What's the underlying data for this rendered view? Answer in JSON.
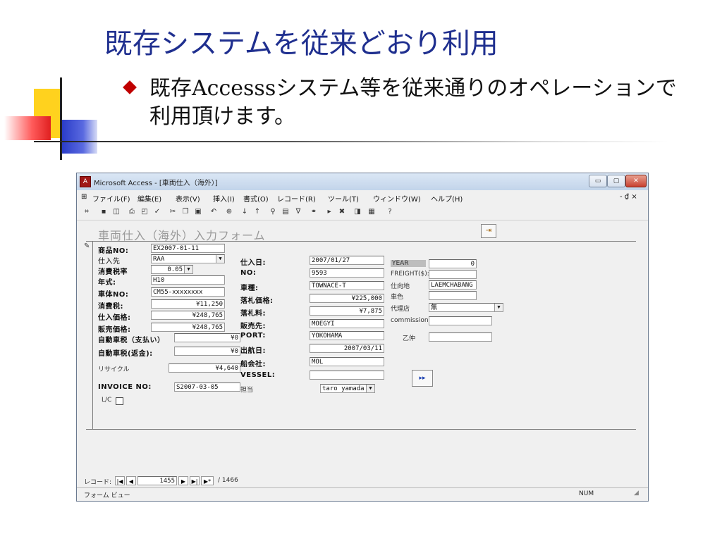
{
  "slide": {
    "title": "既存システムを従来どおり利用",
    "bullet": "既存Accesssシステム等を従来通りのオペレーションで利用頂けます。"
  },
  "window": {
    "title": "Microsoft Access - [車両仕入（海外）]",
    "minimize": "▭",
    "maximize": "▢",
    "close": "✕",
    "child_controls": "- ₫ ×"
  },
  "menu": [
    "ファイル(F)",
    "編集(E)",
    "表示(V)",
    "挿入(I)",
    "書式(O)",
    "レコード(R)",
    "ツール(T)",
    "ウィンドウ(W)",
    "ヘルプ(H)"
  ],
  "form": {
    "title": "車両仕入（海外）入力フォーム",
    "left_fields": [
      {
        "label": "商品NO:",
        "value": "EX2007-01-11"
      },
      {
        "label": "仕入先",
        "value": "RAA"
      },
      {
        "label": "消費税率",
        "value": "0.05"
      },
      {
        "label": "年式:",
        "value": "H10"
      },
      {
        "label": "車体NO:",
        "value": "CM55-xxxxxxxx"
      },
      {
        "label": "消費税:",
        "value": "¥11,250"
      },
      {
        "label": "仕入価格:",
        "value": "¥248,765"
      },
      {
        "label": "販売価格:",
        "value": "¥248,765"
      },
      {
        "label": "自動車税（支払い）",
        "value": "¥0"
      },
      {
        "label": "自動車税(返金):",
        "value": "¥0"
      },
      {
        "label": "リサイクル",
        "value": "¥4,640"
      }
    ],
    "mid_fields": [
      {
        "label": "仕入日:",
        "value": "2007/01/27"
      },
      {
        "label": "NO:",
        "value": "9593"
      },
      {
        "label": "車種:",
        "value": "TOWNACE-T"
      },
      {
        "label": "落札価格:",
        "value": "¥225,000"
      },
      {
        "label": "落札料:",
        "value": "¥7,875"
      },
      {
        "label": "販売先:",
        "value": "MOEGYI"
      },
      {
        "label": "PORT:",
        "value": "YOKOHAMA"
      },
      {
        "label": "出航日:",
        "value": "2007/03/11"
      },
      {
        "label": "船会社:",
        "value": "MOL"
      },
      {
        "label": "VESSEL:",
        "value": ""
      }
    ],
    "right_fields": [
      {
        "label": "YEAR",
        "value": "0"
      },
      {
        "label": "FREIGHT($):",
        "value": ""
      },
      {
        "label": "仕向地",
        "value": "LAEMCHABANG"
      },
      {
        "label": "車色",
        "value": ""
      },
      {
        "label": "代理店",
        "value": "無"
      },
      {
        "label": "commission",
        "value": ""
      },
      {
        "label": "乙仲",
        "value": ""
      }
    ],
    "invoice_label": "INVOICE NO:",
    "invoice_value": "S2007-03-05",
    "tanto_label": "担当",
    "tanto_value": "taro yamada",
    "lc_label": "L/C",
    "nav_button": "▸▸"
  },
  "navigator": {
    "label": "レコード:",
    "current": "1455",
    "total": "/ 1466"
  },
  "status": {
    "left": "フォーム ビュー",
    "right": "NUM"
  }
}
